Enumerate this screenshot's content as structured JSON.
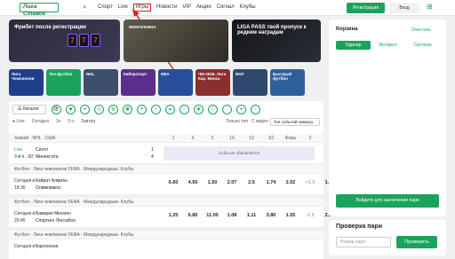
{
  "header": {
    "logo": "Лига Ставок",
    "nav": [
      "Спорт",
      "Live",
      "Игры",
      "Новости",
      "VIP",
      "Акции",
      "Сигнал",
      "Клубы"
    ],
    "register": "Регистрация",
    "login": "Вход"
  },
  "banners": [
    {
      "title": "Фрибет после регистрации",
      "slots": [
        "7",
        "7",
        "7"
      ]
    },
    {
      "title": "ЖЕМЧУЖИНА"
    },
    {
      "title": "LIGA PASS твой пропуск к редким наградам"
    }
  ],
  "categories": [
    {
      "label": "Лига Чемпионов",
      "color": "#1f3e8a"
    },
    {
      "label": "Топ-футбол",
      "color": "#1ba35c"
    },
    {
      "label": "NHL",
      "color": "#3d4f6a"
    },
    {
      "label": "Киберспорт",
      "color": "#5a2e8a"
    },
    {
      "label": "NBA",
      "color": "#264e9a"
    },
    {
      "label": "ЧМ-2026. Лига Кар. Минск",
      "color": "#8a2e2e"
    },
    {
      "label": "ВХЛ",
      "color": "#2e4870"
    },
    {
      "label": "Быстрый футбол",
      "color": "#2e5f9a"
    },
    {
      "label": "Настольный теннис",
      "color": "#1f6a3e"
    }
  ],
  "toolbar": {
    "catalog": "Каталог",
    "filters": [
      "Live",
      "Сегодня",
      "1ч",
      "3 ч",
      "Завтра"
    ],
    "top_only": "Только топ",
    "with_video": "С видео",
    "sort": "Топ событий наверху"
  },
  "odds_cols": [
    "1",
    "X",
    "2",
    "1X",
    "12",
    "X2",
    "Фора",
    "2"
  ],
  "groups": [
    {
      "head": "Хоккей · NHL · США",
      "rows": [
        {
          "time": "Live",
          "time2": "3-й п., 60'",
          "t1": "Сиэтл",
          "t2": "Миннесота",
          "s1": "1",
          "s2": "4",
          "note": "Событие обновляется"
        }
      ]
    },
    {
      "head": "Футбол · Лига чемпионов УЕФА · Международные. Клубы",
      "rows": [
        {
          "time": "Сегодня в",
          "time2": "18:30",
          "t1": "Кайрат Алматы",
          "t2": "Олимпиакос",
          "odds": [
            "6.60",
            "4.50",
            "1.50",
            "2.07",
            "2.5",
            "1.74",
            "2.02",
            "+1.5",
            "1.76"
          ]
        }
      ]
    },
    {
      "head": "Футбол · Лига чемпионов УЕФА · Международные. Клубы",
      "rows": [
        {
          "time": "Сегодня в",
          "time2": "20:45",
          "t1": "Бавария Мюнхен",
          "t2": "Спортинг Лиссабон",
          "odds": [
            "1.25",
            "6.80",
            "11.00",
            "1.08",
            "1.11",
            "3.80",
            "1.55",
            "-2.5",
            "2.20"
          ]
        }
      ]
    },
    {
      "head": "Футбол · Лига чемпионов УЕФА · Международные. Клубы",
      "rows": [
        {
          "time": "Сегодня в",
          "time2": "",
          "t1": "Барселона",
          "t2": ""
        }
      ]
    }
  ],
  "cart": {
    "title": "Корзина",
    "clear": "Очистить",
    "tabs": [
      "Одинар",
      "Экспресс",
      "Система"
    ],
    "place": "Войдите для заключения пари"
  },
  "check": {
    "title": "Проверка пари",
    "placeholder": "Номер пари",
    "button": "Проверить"
  }
}
